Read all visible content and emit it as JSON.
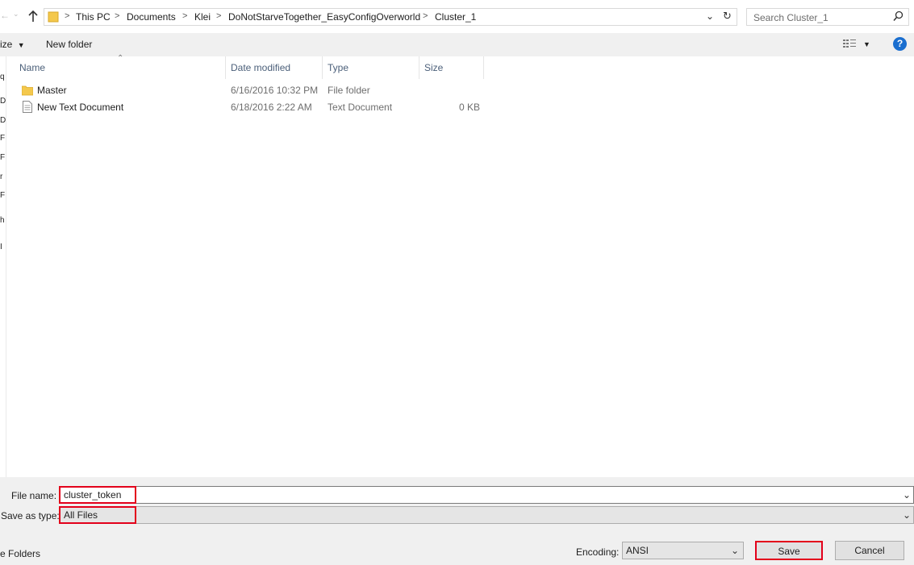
{
  "address_bar": {
    "breadcrumbs": [
      "This PC",
      "Documents",
      "Klei",
      "DoNotStarveTogether_EasyConfigOverworld",
      "Cluster_1"
    ],
    "separator": ">"
  },
  "search": {
    "placeholder": "Search Cluster_1"
  },
  "toolbar": {
    "organize_label": "ize",
    "new_folder_label": "New folder"
  },
  "nav_pane": {
    "fragments": [
      "q",
      "D",
      "D",
      "F",
      "F",
      "r",
      "F",
      "h",
      "I"
    ]
  },
  "file_list": {
    "columns": [
      "Name",
      "Date modified",
      "Type",
      "Size"
    ],
    "rows": [
      {
        "name": "Master",
        "date": "6/16/2016 10:32 PM",
        "type": "File folder",
        "size": "",
        "icon": "folder-icon"
      },
      {
        "name": "New Text Document",
        "date": "6/18/2016 2:22 AM",
        "type": "Text Document",
        "size": "0 KB",
        "icon": "text-file-icon"
      }
    ]
  },
  "save_form": {
    "file_name_label": "File name:",
    "file_name_value": "cluster_token",
    "save_type_label": "Save as type:",
    "save_type_value": "All Files",
    "hide_folders_label": "e Folders",
    "encoding_label": "Encoding:",
    "encoding_value": "ANSI",
    "save_label": "Save",
    "cancel_label": "Cancel"
  },
  "colors": {
    "highlight": "#e3001b",
    "help": "#1a6ecf",
    "folder": "#f4c84c"
  }
}
